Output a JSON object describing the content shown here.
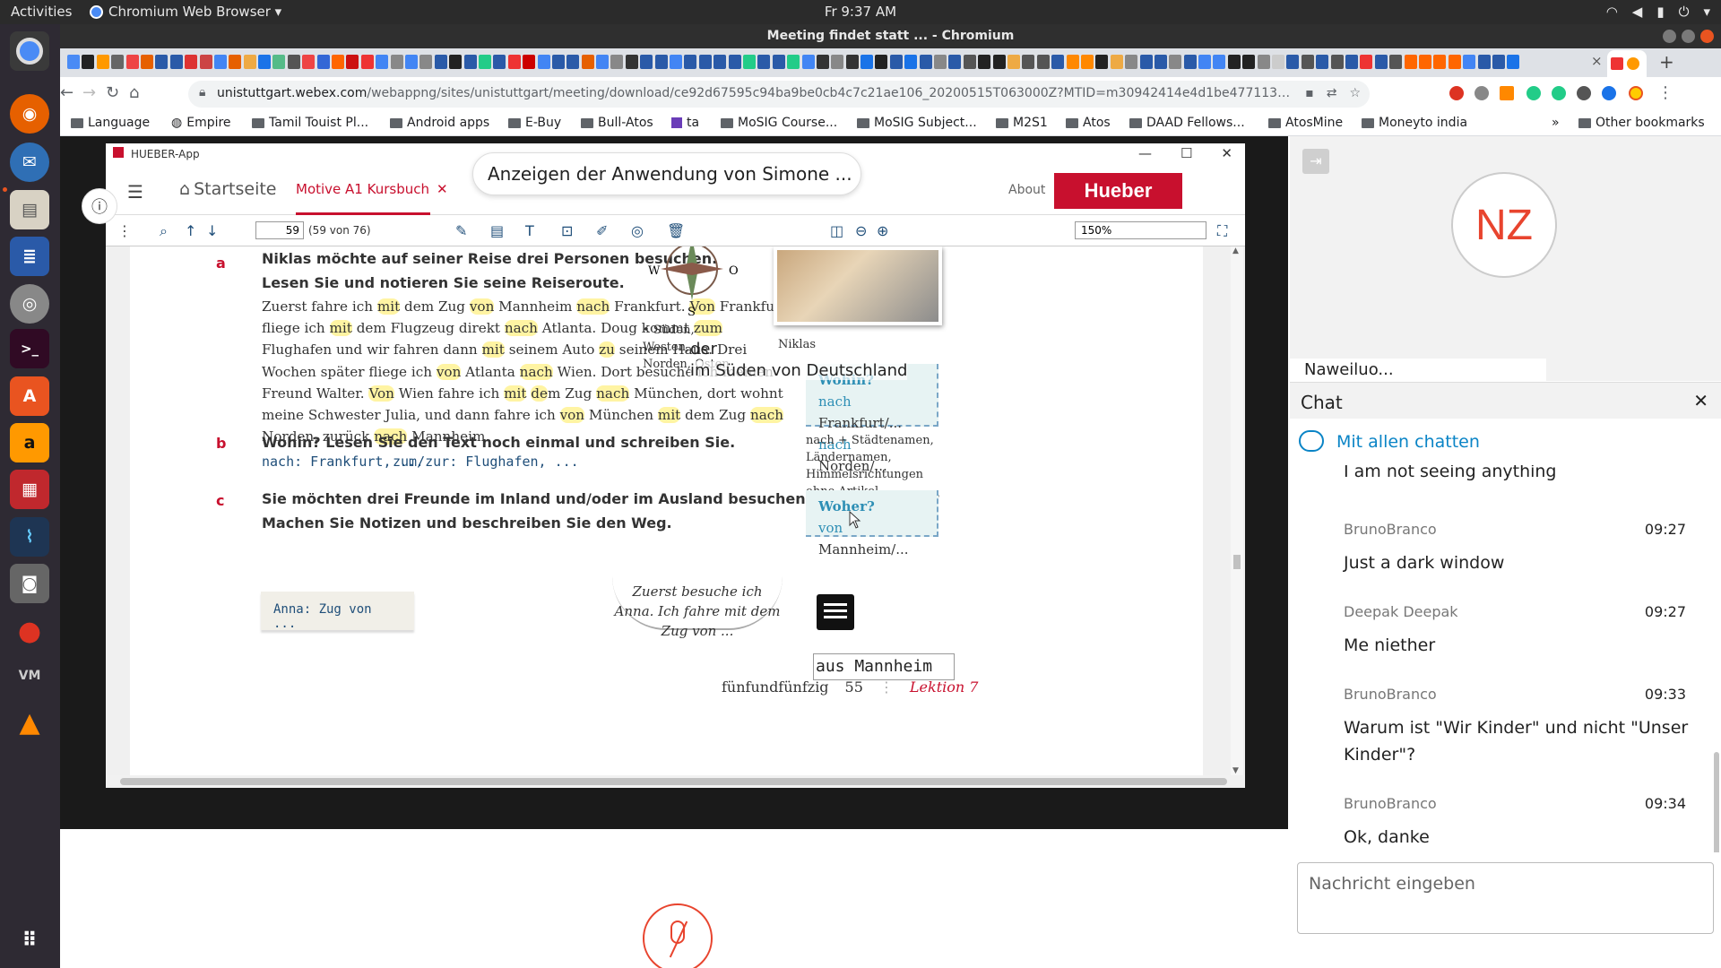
{
  "topbar": {
    "activities": "Activities",
    "app_name": "Chromium Web Browser ▾",
    "clock": "Fr  9:37 AM"
  },
  "window": {
    "title": "Meeting findet statt ... - Chromium"
  },
  "tab": {
    "close": "×",
    "new_tab": "+"
  },
  "omnibox": {
    "url_domain": "unistuttgart.webex.com",
    "url_path": "/webappng/sites/unistuttgart/meeting/download/ce92d67595c94ba9be0cb4c7c21ae106_20200515T063000Z?MTID=m30942414e4d1be477113653036162165&launchApp..."
  },
  "bookmarks": [
    "Language",
    "Empire",
    "Tamil Touist Pl...",
    "Android apps",
    "E-Buy",
    "Bull-Atos",
    "ta",
    "MoSIG Course...",
    "MoSIG Subject...",
    "M2S1",
    "Atos",
    "DAAD Fellows...",
    "AtosMine",
    "Moneyto india"
  ],
  "bookmarks_more": "»",
  "bookmarks_other": "Other bookmarks",
  "hueber": {
    "window_title": "HUEBER-App",
    "home": "Startseite",
    "tab": "Motive A1 Kursbuch",
    "about": "About",
    "logo": "Hueber",
    "page_input": "59",
    "page_count": "(59 von 76)",
    "zoom": "150%"
  },
  "share_banner": "Anzeigen der Anwendung von Simone ...",
  "doc": {
    "a_letter": "a",
    "a_heading_1": "Niklas möchte auf seiner Reise drei Personen besuchen.",
    "a_heading_2": "Lesen Sie und notieren Sie seine Reiseroute.",
    "b_letter": "b",
    "b_heading": "Wohin? Lesen Sie den Text noch einmal und schreiben Sie.",
    "b_example_1": "nach: Frankfurt, ...",
    "b_example_2": "zum/zur: Flughafen, ...",
    "c_letter": "c",
    "c_heading_1": "Sie möchten drei Freunde im Inland und/oder im Ausland besuchen. Wie reisen Sie?",
    "c_heading_2": "Machen Sie Notizen und beschreiben Sie den Weg.",
    "sticky_note": "Anna: Zug von ...",
    "speech_bubble": "Zuerst besuche ich Anna. Ich fahre mit dem Zug von ...",
    "compass_w": "W",
    "compass_o": "O",
    "compass_s": "S",
    "compass_caption": "• Süden, Westen, Norden, Osten",
    "photo_caption": "Niklas",
    "overlay_der": "der",
    "overlay_sueden": "im Süden von Deutschland",
    "wohin_title": "Wohin?",
    "wohin_1_kw": "nach",
    "wohin_1": "Frankfurt/...",
    "wohin_2_kw": "nach",
    "wohin_2": "Norden/...",
    "nach_note": "nach + Städtenamen, Ländernamen, Himmelsrichtungen ohne Artikel",
    "woher_title": "Woher?",
    "woher_kw": "von",
    "woher_1": "Mannheim/...",
    "annotation_text": "aus Mannheim",
    "footer_word": "fünfundfünfzig",
    "footer_num": "55",
    "footer_lesson": "Lektion 7"
  },
  "participant": {
    "initials": "NZ",
    "name": "Naweiluo..."
  },
  "chat": {
    "title": "Chat",
    "to_label": "Mit allen chatten",
    "messages": [
      {
        "sender": "",
        "time": "",
        "text": "I am not seeing anything"
      },
      {
        "sender": "BrunoBranco",
        "time": "09:27",
        "text": "Just a dark window"
      },
      {
        "sender": "Deepak Deepak",
        "time": "09:27",
        "text": "Me niether"
      },
      {
        "sender": "BrunoBranco",
        "time": "09:33",
        "text": "Warum ist \"Wir Kinder\" und nicht \"Unser Kinder\"?"
      },
      {
        "sender": "BrunoBranco",
        "time": "09:34",
        "text": "Ok, danke"
      }
    ],
    "input_placeholder": "Nachricht eingeben"
  }
}
